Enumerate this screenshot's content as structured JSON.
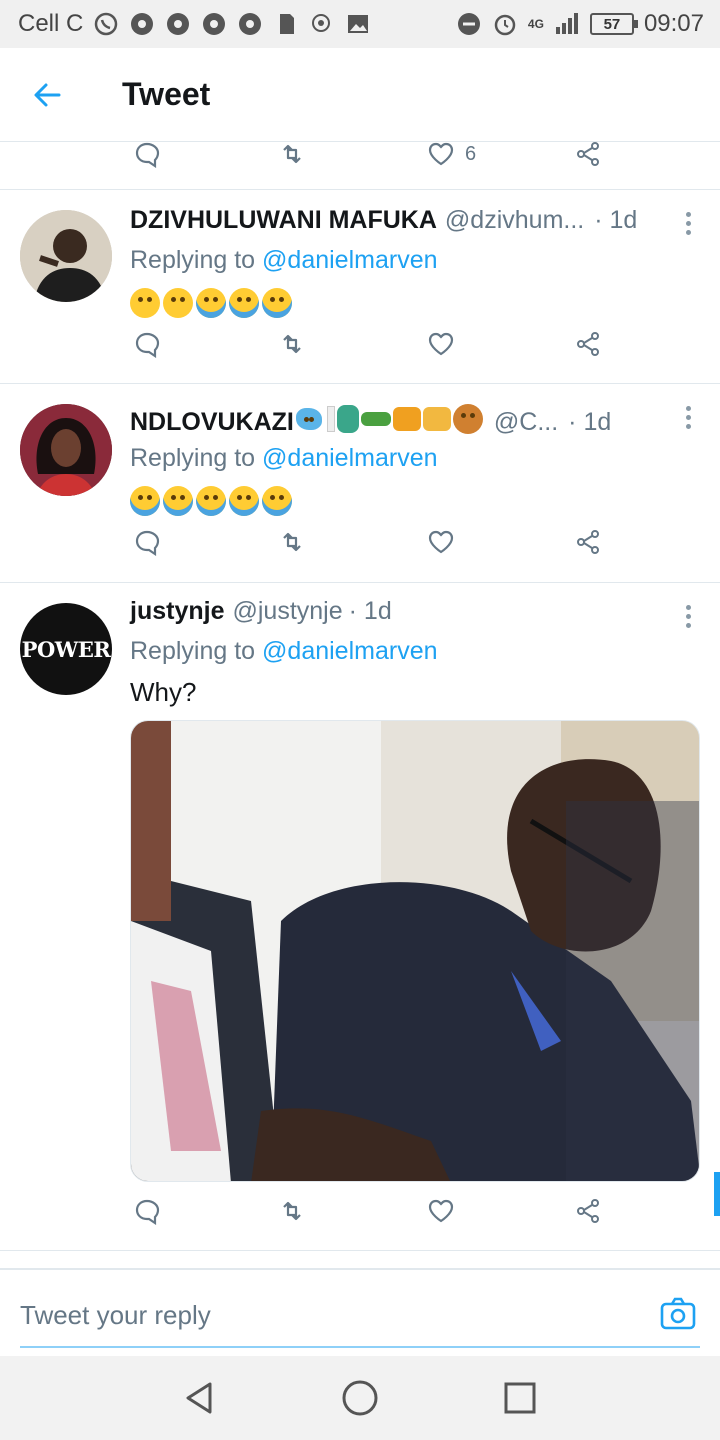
{
  "status_bar": {
    "carrier": "Cell C",
    "network": "4G",
    "battery": "57",
    "time": "09:07"
  },
  "header": {
    "title": "Tweet"
  },
  "partial_tweet": {
    "like_count": "6"
  },
  "tweets": [
    {
      "name": "DZIVHULUWANI MAFUKA",
      "handle": "@dzivhum...",
      "time": "· 1d",
      "replying_prefix": "Replying to ",
      "replying_to": "@danielmarven"
    },
    {
      "name": "NDLOVUKAZI",
      "handle": "@C...",
      "time": "· 1d",
      "replying_prefix": "Replying to ",
      "replying_to": "@danielmarven"
    },
    {
      "name": "justynje",
      "handle": "@justynje",
      "time": "· 1d",
      "replying_prefix": "Replying to ",
      "replying_to": "@danielmarven",
      "text": "Why?",
      "avatar_text": "POWER"
    }
  ],
  "composer": {
    "placeholder": "Tweet your reply"
  },
  "colors": {
    "accent": "#1da1f2",
    "muted": "#657786",
    "divider": "#e1e8ed"
  }
}
